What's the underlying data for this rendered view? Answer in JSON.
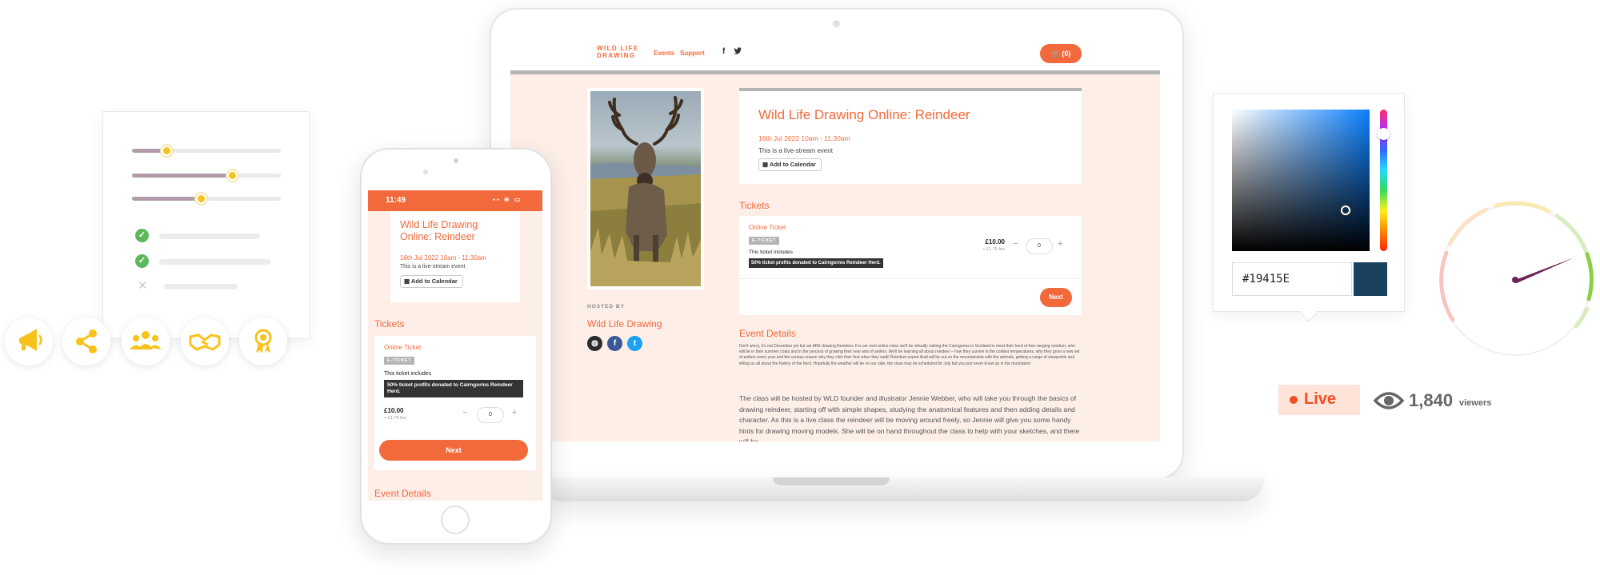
{
  "colors": {
    "brand": "#f26a3c",
    "page_background": "#fdeee8",
    "settings_accent": "#f7c21a",
    "check_green": "#5cb85c",
    "picker_swatch": "#19415E",
    "live_red": "#f04e23"
  },
  "desktop_site": {
    "logo_line1": "WILD LIFE",
    "logo_line2": "DRAWING",
    "nav": [
      "Events",
      "Support"
    ],
    "social_icons": [
      "facebook-icon",
      "twitter-icon"
    ],
    "cart_label": "(0)",
    "event": {
      "title": "Wild Life Drawing Online: Reindeer",
      "date": "16th Jul 2022 10am - 11:30am",
      "live_note": "This is a live-stream event",
      "add_to_calendar": "Add to Calendar"
    },
    "host": {
      "hosted_by": "HOSTED BY",
      "name": "Wild Life Drawing",
      "icons": [
        "globe-icon",
        "facebook-icon",
        "twitter-icon"
      ]
    },
    "tickets": {
      "heading": "Tickets",
      "name": "Online Ticket",
      "badge": "E-TICKET",
      "includes": "This ticket includes",
      "note": "50% ticket profits donated to Cairngorms Reindeer Herd.",
      "price": "£10.00",
      "fee": "+ £1.76 fee",
      "quantity": "0",
      "next": "Next"
    },
    "details": {
      "heading": "Event Details",
      "small_text": "Don't worry, it's not December yet but we ARE drawing Reindeer. For our next online class we'll be virtually visiting the Cairngorms in Scotland to meet their herd of free-ranging reindeer, who will be in their summer coats and in the process of growing their new sets of antlers. We'll be learning all about reindeer – how they survive in the coldest temperatures, why they grow a new set of antlers every year and the curious reason why they click their feet when they walk! Reindeer expert Andi will be out on the mountainside with the animals, getting a range of viewpoints and telling us all about the history of the herd. Hopefully the weather will be on our side, the class may be scheduled for July but you just never know up in the mountains!",
      "large_text": "The class will be hosted by WLD founder and illustrator Jennie Webber, who will take you through the basics of drawing reindeer, starting off with simple shapes, studying the anatomical features and then adding details and character. As this is a live class the reindeer will be moving around freely, so Jennie will give you some handy hints for drawing moving models. She will be on hand throughout the class to help with your sketches, and there will be"
    }
  },
  "mobile_site": {
    "time": "11:49",
    "event": {
      "title": "Wild Life Drawing Online: Reindeer",
      "date": "16th Jul 2022 10am - 11:30am",
      "live_note": "This is a live-stream event",
      "add_to_calendar": "Add to Calendar"
    },
    "tickets": {
      "heading": "Tickets",
      "name": "Online Ticket",
      "badge": "E-TICKET",
      "includes": "This ticket includes",
      "note": "50% ticket profits donated to Cairngorms Reindeer Herd.",
      "price": "£10.00",
      "fee": "+ £1.76 fee",
      "quantity": "0",
      "next": "Next"
    },
    "details_heading": "Event Details"
  },
  "settings_widget": {
    "sliders": [
      0.23,
      0.67,
      0.46
    ],
    "checklist": [
      "check",
      "check",
      "cross"
    ]
  },
  "feature_icons": [
    "megaphone-icon",
    "share-icon",
    "group-icon",
    "handshake-icon",
    "award-icon"
  ],
  "color_picker": {
    "hex_value": "#19415E"
  },
  "live_stats": {
    "live_label": "Live",
    "viewers_count": "1,840",
    "viewers_label": "viewers"
  }
}
